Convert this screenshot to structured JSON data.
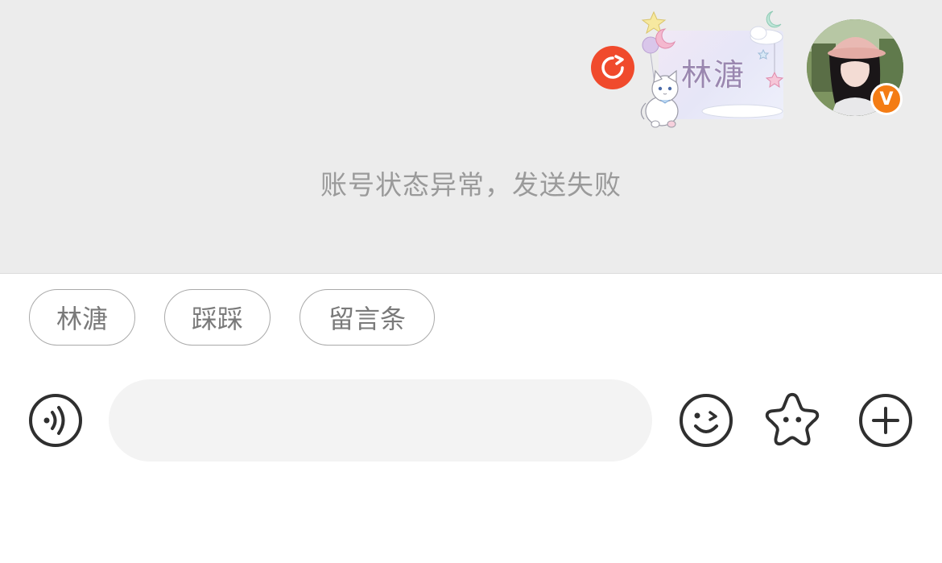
{
  "chat": {
    "message_text": "林溏",
    "system_notice": "账号状态异常，发送失败",
    "verified_badge": "V"
  },
  "quick_replies": [
    "林溏",
    "踩踩",
    "留言条"
  ],
  "input_bar": {
    "placeholder": "",
    "value": ""
  },
  "colors": {
    "chat_background": "#ececec",
    "retry_red": "#f04a2c",
    "badge_orange": "#f47c14",
    "notice_text": "#9a9a9a",
    "message_text": "#9a87b0"
  },
  "icons": {
    "retry": "retry-icon",
    "voice": "voice-icon",
    "emoji": "emoji-icon",
    "sticker": "star-sticker-icon",
    "more": "plus-icon"
  }
}
